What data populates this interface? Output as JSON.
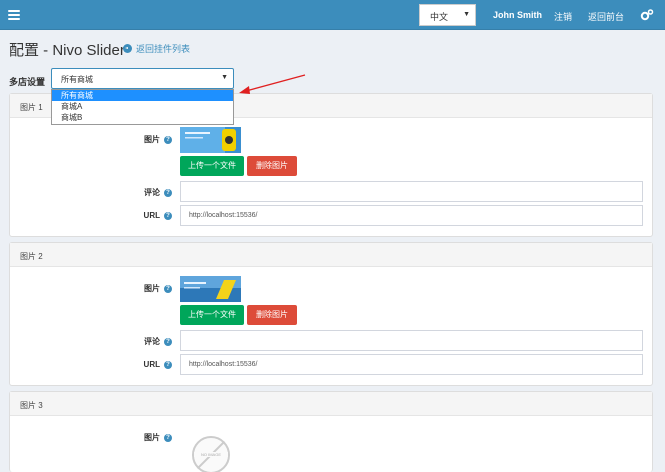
{
  "topbar": {
    "language": "中文",
    "user_name": "John Smith",
    "logout_label": "注销",
    "frontend_label": "返回前台",
    "menu_icon": "hamburger-menu-icon",
    "settings_icon": "gears-icon"
  },
  "page": {
    "title": "配置 - Nivo Slider",
    "back_link": "返回挂件列表"
  },
  "store": {
    "label": "多店设置",
    "selected": "所有商城",
    "options": [
      "所有商城",
      "商城A",
      "商城B"
    ]
  },
  "pictures": [
    {
      "header": "图片 1",
      "picture_label": "图片",
      "upload_label": "上传一个文件",
      "delete_label": "删除图片",
      "comment_label": "评论",
      "comment_value": "",
      "url_label": "URL",
      "url_value": "http://localhost:15536/"
    },
    {
      "header": "图片 2",
      "picture_label": "图片",
      "upload_label": "上传一个文件",
      "delete_label": "删除图片",
      "comment_label": "评论",
      "comment_value": "",
      "url_label": "URL",
      "url_value": "http://localhost:15536/"
    },
    {
      "header": "图片 3",
      "picture_label": "图片",
      "noimage_text": "NO IMAGE"
    }
  ],
  "colors": {
    "topbar": "#3c8dbc",
    "upload_button": "#00a65a",
    "delete_button": "#dd4b39",
    "annotation_arrow": "#e02020"
  }
}
